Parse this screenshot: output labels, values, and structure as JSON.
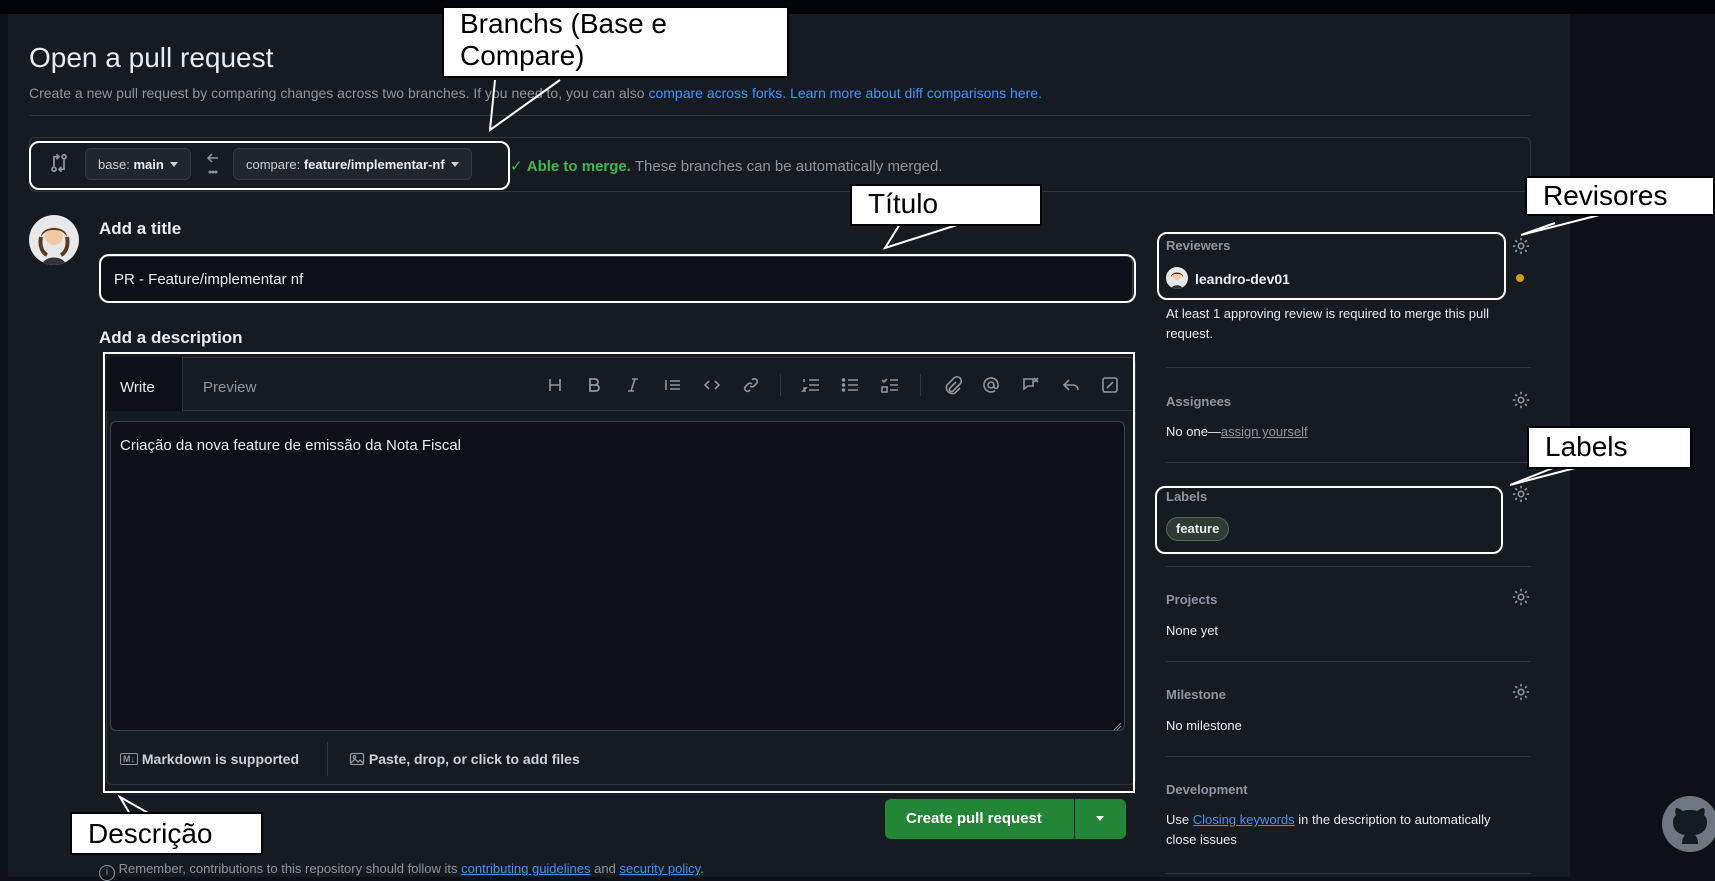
{
  "header": {
    "title": "Open a pull request",
    "subtitle_prefix": "Create a new pull request by comparing changes across two branches. If you need to, you can also",
    "link_forks": "compare across forks.",
    "link_learn": "Learn more about diff comparisons here."
  },
  "compare": {
    "base_label": "base:",
    "base_value": "main",
    "compare_label": "compare:",
    "compare_value": "feature/implementar-nf",
    "merge_ok": "Able to merge.",
    "merge_msg": "These branches can be automatically merged."
  },
  "form": {
    "title_heading": "Add a title",
    "title_value": "PR - Feature/implementar nf",
    "desc_heading": "Add a description",
    "tab_write": "Write",
    "tab_preview": "Preview",
    "desc_value": "Criação da nova feature de emissão da Nota Fiscal",
    "markdown_note": "Markdown is supported",
    "attach_note": "Paste, drop, or click to add files",
    "create_button": "Create pull request",
    "footer_prefix": "Remember, contributions to this repository should follow its",
    "footer_link1": "contributing guidelines",
    "footer_and": "and",
    "footer_link2": "security policy",
    "footer_end": "."
  },
  "sidebar": {
    "reviewers_heading": "Reviewers",
    "reviewer_name": "leandro-dev01",
    "reviewers_note": "At least 1 approving review is required to merge this pull request.",
    "assignees_heading": "Assignees",
    "assignees_none": "No one—",
    "assign_yourself": "assign yourself",
    "labels_heading": "Labels",
    "label_feature": "feature",
    "projects_heading": "Projects",
    "projects_value": "None yet",
    "milestone_heading": "Milestone",
    "milestone_value": "No milestone",
    "development_heading": "Development",
    "dev_use": "Use",
    "dev_link": "Closing keywords",
    "dev_rest": "in the description to automatically close issues"
  },
  "annotations": {
    "branchs": "Branchs (Base e Compare)",
    "titulo": "Título",
    "revisores": "Revisores",
    "labels": "Labels",
    "descricao": "Descrição"
  },
  "colors": {
    "background": "#0d1117",
    "accent_link": "#4493f8",
    "merge_green": "#3fb950",
    "button_green": "#238636",
    "pending_dot": "#d29922"
  }
}
